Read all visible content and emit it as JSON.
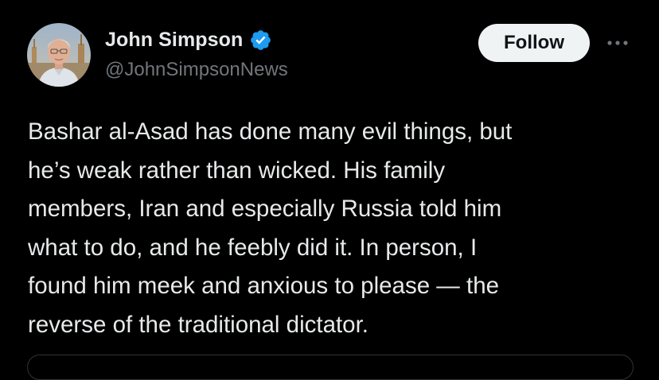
{
  "author": {
    "display_name": "John Simpson",
    "handle": "@JohnSimpsonNews",
    "verified": true,
    "verified_icon": "verified-badge-icon",
    "avatar_icon": "avatar-photo"
  },
  "actions": {
    "follow_label": "Follow",
    "more_icon": "more-dots-icon"
  },
  "tweet": {
    "text": "Bashar al-Asad has done many evil things, but\nhe’s weak rather than wicked.  His family\nmembers, Iran and especially Russia told him\nwhat to do, and he feebly did it.  In person, I\nfound him meek and anxious to please — the\nreverse of the traditional dictator."
  },
  "colors": {
    "background": "#000000",
    "text_primary": "#e7e9ea",
    "text_secondary": "#71767b",
    "verified_blue": "#1d9bf0",
    "button_bg": "#eff3f4",
    "button_text": "#0f1419",
    "border": "#2f3336"
  }
}
